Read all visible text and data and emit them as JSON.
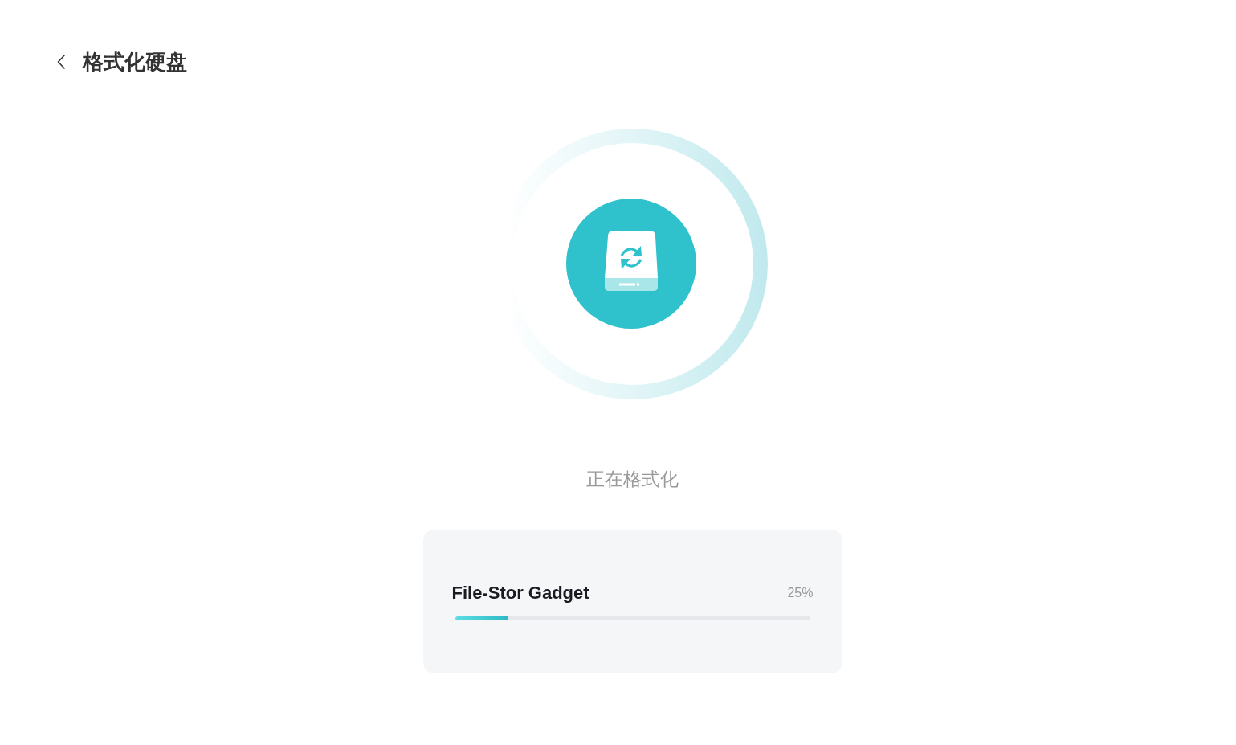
{
  "header": {
    "title": "格式化硬盘"
  },
  "status": "正在格式化",
  "device": {
    "name": "File-Stor Gadget",
    "percent": "25%",
    "level": 0.15
  }
}
